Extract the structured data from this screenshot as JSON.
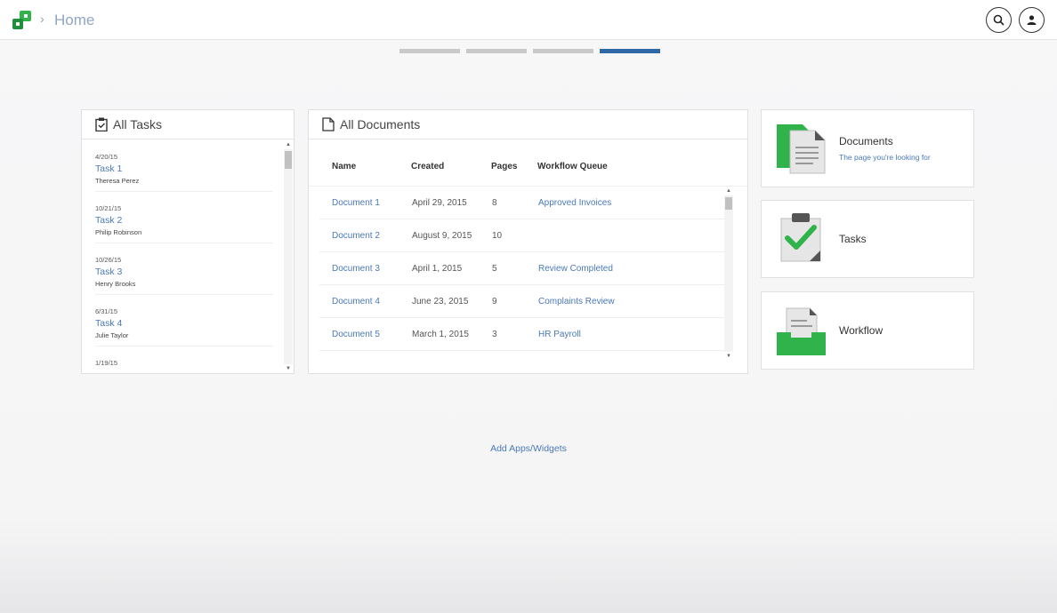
{
  "header": {
    "breadcrumb_separator": "›",
    "breadcrumb_home": "Home",
    "search_icon": "search-icon",
    "user_icon": "user-icon"
  },
  "pager": {
    "pages": 4,
    "active_index": 3,
    "active_color": "#2f68a6"
  },
  "tasks_widget": {
    "title": "All Tasks",
    "items": [
      {
        "date": "4/20/15",
        "name": "Task 1",
        "person": "Theresa Perez"
      },
      {
        "date": "10/21/15",
        "name": "Task 2",
        "person": "Philip Robinson"
      },
      {
        "date": "10/26/15",
        "name": "Task 3",
        "person": "Henry Brooks"
      },
      {
        "date": "6/31/15",
        "name": "Task 4",
        "person": "Julie Taylor"
      },
      {
        "date": "1/19/15",
        "name": "",
        "person": ""
      }
    ]
  },
  "docs_widget": {
    "title": "All Documents",
    "columns": {
      "name": "Name",
      "created": "Created",
      "pages": "Pages",
      "queue": "Workflow Queue"
    },
    "rows": [
      {
        "name": "Document 1",
        "created": "April 29, 2015",
        "pages": "8",
        "queue": "Approved Invoices"
      },
      {
        "name": "Document 2",
        "created": "August 9, 2015",
        "pages": "10",
        "queue": ""
      },
      {
        "name": "Document 3",
        "created": "April 1, 2015",
        "pages": "5",
        "queue": "Review Completed"
      },
      {
        "name": "Document 4",
        "created": "June 23, 2015",
        "pages": "9",
        "queue": "Complaints Review"
      },
      {
        "name": "Document 5",
        "created": "March 1, 2015",
        "pages": "3",
        "queue": "HR Payroll"
      }
    ]
  },
  "apps": {
    "documents": {
      "title": "Documents",
      "subtitle": "The page you're looking for"
    },
    "tasks": {
      "title": "Tasks"
    },
    "workflow": {
      "title": "Workflow"
    }
  },
  "footer": {
    "add_apps_label": "Add Apps/Widgets"
  },
  "colors": {
    "brand_green": "#2fb34a",
    "link_blue": "#4a79b8"
  }
}
